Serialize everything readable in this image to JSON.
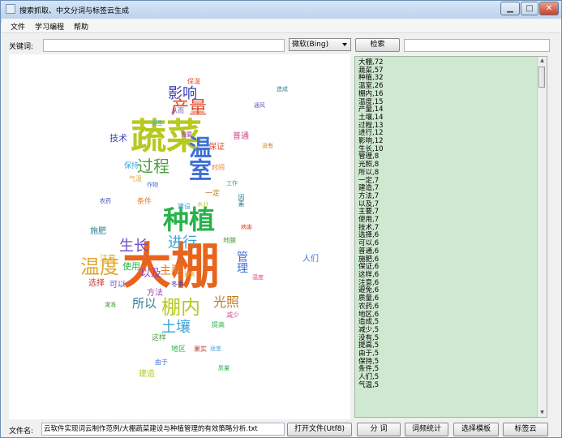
{
  "window": {
    "title": "搜索抓取、中文分词与标签云生成",
    "min_label": "▁",
    "max_label": "□",
    "close_label": "✕",
    "icon": "app-icon"
  },
  "menu": [
    "文件",
    "学习编程",
    "帮助"
  ],
  "search": {
    "keyword_label": "关键词:",
    "keyword_value": "",
    "engine_value": "微软(Bing)",
    "search_button": "检索",
    "extra_value": ""
  },
  "cloud": {
    "words": [
      {
        "text": "大棚",
        "color": "#e8641d"
      },
      {
        "text": "蔬菜",
        "color": "#b7c91f"
      },
      {
        "text": "种植",
        "color": "#27b34a"
      },
      {
        "text": "温室",
        "color": "#3f6fd6"
      },
      {
        "text": "温度",
        "color": "#e0a830"
      },
      {
        "text": "产量",
        "color": "#e0492a"
      },
      {
        "text": "影响",
        "color": "#3a3fb0"
      },
      {
        "text": "过程",
        "color": "#4b9e3c"
      },
      {
        "text": "棚内",
        "color": "#b7c91f"
      },
      {
        "text": "进行",
        "color": "#3aa3d6"
      },
      {
        "text": "生长",
        "color": "#6b4fc8"
      },
      {
        "text": "土壤",
        "color": "#3aa3d6"
      },
      {
        "text": "光照",
        "color": "#c07a22"
      },
      {
        "text": "所以",
        "color": "#2f7f8f"
      },
      {
        "text": "以及",
        "color": "#9c3fb3"
      },
      {
        "text": "主要",
        "color": "#e07a2a"
      },
      {
        "text": "管理",
        "color": "#3f6fd6"
      },
      {
        "text": "技术",
        "color": "#3a3fb0"
      },
      {
        "text": "保证",
        "color": "#e0492a"
      },
      {
        "text": "普通",
        "color": "#d24a8a"
      },
      {
        "text": "使用",
        "color": "#27b34a"
      },
      {
        "text": "注意",
        "color": "#e0a830"
      },
      {
        "text": "选择",
        "color": "#c0392b"
      },
      {
        "text": "可以",
        "color": "#6b4fc8"
      },
      {
        "text": "施肥",
        "color": "#2f7f8f"
      },
      {
        "text": "建造",
        "color": "#b7c91f"
      },
      {
        "text": "人们",
        "color": "#3f6fd6"
      },
      {
        "text": "方法",
        "color": "#9c3fb3"
      },
      {
        "text": "地区",
        "color": "#27b34a"
      },
      {
        "text": "条件",
        "color": "#e07a2a"
      },
      {
        "text": "保持",
        "color": "#3aa3d6"
      },
      {
        "text": "这样",
        "color": "#4b9e3c"
      },
      {
        "text": "一定",
        "color": "#c07a22"
      },
      {
        "text": "建设",
        "color": "#3aa3d6"
      },
      {
        "text": "保温",
        "color": "#e0492a"
      },
      {
        "text": "从而",
        "color": "#6b4fc8"
      },
      {
        "text": "因素",
        "color": "#2f7f8f"
      },
      {
        "text": "冬季",
        "color": "#3a3fb0"
      },
      {
        "text": "提高",
        "color": "#27b34a"
      },
      {
        "text": "气温",
        "color": "#e0a830"
      },
      {
        "text": "由于",
        "color": "#3f6fd6"
      },
      {
        "text": "减少",
        "color": "#d24a8a"
      },
      {
        "text": "地膜",
        "color": "#4b9e3c"
      },
      {
        "text": "果实",
        "color": "#c0392b"
      },
      {
        "text": "需要",
        "color": "#9c3fb3"
      },
      {
        "text": "发生",
        "color": "#3aa3d6"
      },
      {
        "text": "时间",
        "color": "#e07a2a"
      },
      {
        "text": "工作",
        "color": "#27b34a"
      },
      {
        "text": "作物",
        "color": "#3f6fd6"
      },
      {
        "text": "水分",
        "color": "#b7c91f"
      },
      {
        "text": "病害",
        "color": "#e0492a"
      },
      {
        "text": "通风",
        "color": "#6b4fc8"
      },
      {
        "text": "造成",
        "color": "#2f7f8f"
      },
      {
        "text": "没有",
        "color": "#c07a22"
      },
      {
        "text": "农药",
        "color": "#3a3fb0"
      },
      {
        "text": "质量",
        "color": "#27b34a"
      },
      {
        "text": "避免",
        "color": "#e0a830"
      },
      {
        "text": "适宜",
        "color": "#3aa3d6"
      },
      {
        "text": "湿度",
        "color": "#d24a8a"
      },
      {
        "text": "灌溉",
        "color": "#4b9e3c"
      }
    ]
  },
  "frequency_list": [
    "大棚,72",
    "蔬菜,57",
    "种植,32",
    "温室,26",
    "棚内,16",
    "温度,15",
    "产量,14",
    "土壤,14",
    "过程,13",
    "进行,12",
    "影响,12",
    "生长,10",
    "管理,8",
    "光照,8",
    "所以,8",
    "一定,7",
    "建造,7",
    "方法,7",
    "以及,7",
    "主要,7",
    "使用,7",
    "技术,7",
    "选择,6",
    "可以,6",
    "普通,6",
    "施肥,6",
    "保证,6",
    "这样,6",
    "注意,6",
    "避免,6",
    "质量,6",
    "农药,6",
    "地区,6",
    "造成,5",
    "减少,5",
    "没有,5",
    "提高,5",
    "由于,5",
    "保持,5",
    "条件,5",
    "人们,5",
    "气温,5"
  ],
  "bottom": {
    "filename_label": "文件名:",
    "filename_value": "云软件实现词云制作范例/大棚蔬菜建设与种植管理的有效策略分析.txt",
    "open_button": "打开文件(Utf8)",
    "segment_button": "分 词",
    "stats_button": "词频统计",
    "template_button": "选择模板",
    "tagcloud_button": "标签云"
  }
}
